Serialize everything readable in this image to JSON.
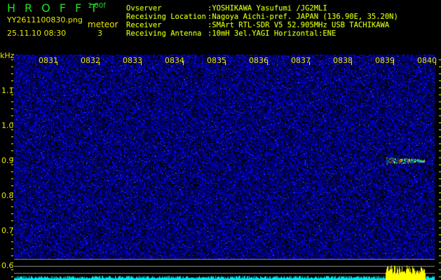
{
  "header": {
    "app_name": "HROFFT",
    "version": "1.00f",
    "filename": "YY2611100830.png",
    "datetime": "25.11.10 08:30",
    "meteor_label": "meteor",
    "meteor_count": "3"
  },
  "info": [
    {
      "label": "Ovserver",
      "value": ":YOSHIKAWA Yasufumi /JG2MLI"
    },
    {
      "label": "Receiving Location",
      "value": ":Nagoya Aichi-pref. JAPAN (136.90E, 35.20N)"
    },
    {
      "label": "Receiver",
      "value": ":SMArt RTL-SDR V5 52.905MHz USB TACHIKAWA"
    },
    {
      "label": "Receiving Antenna",
      "value": ":10mH 3el.YAGI Horizontal:ENE"
    }
  ],
  "axis": {
    "unit": "kHz",
    "freq_labels": [
      "1.1",
      "1.0",
      "0.9",
      "0.8",
      "0.7",
      "0.6"
    ],
    "time_labels": [
      "0831",
      "0832",
      "0833",
      "0834",
      "0835",
      "0836",
      "0837",
      "0838",
      "0839",
      "0840"
    ]
  },
  "colors": {
    "text": "#e8e800",
    "title": "#22dd22",
    "noise": "#1020c0",
    "level": "#00e8f0",
    "event_level": "#ffff00"
  },
  "events": [
    {
      "time": "08:39",
      "freq_khz": 0.9
    }
  ]
}
